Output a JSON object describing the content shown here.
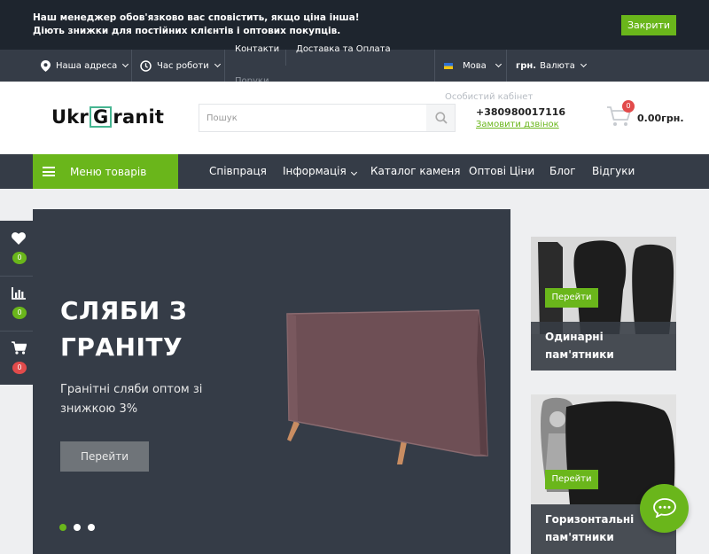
{
  "notice": {
    "line1": "Наш менеджер обов'язково вас сповістить, якщо ціна інша!",
    "line2": "Діють знижки для постійних клієнтів і оптових покупців.",
    "close_label": "Закрити"
  },
  "topbar": {
    "address_label": "Наша адреса",
    "hours_label": "Час роботи",
    "links": [
      "Контакти",
      "Доставка та Оплата",
      "Поруки"
    ],
    "language_label": "Мова",
    "currency_code": "грн.",
    "currency_label": "Валюта",
    "account_label": "Особистий кабінет"
  },
  "header": {
    "logo_pre": "Ukr",
    "logo_g": "G",
    "logo_post": "ranit",
    "search_placeholder": "Пошук",
    "phone": "+380980017116",
    "callback_label": "Замовити дзвінок",
    "cart_count": "0",
    "cart_total": "0.00грн."
  },
  "nav": {
    "menu_label": "Меню товарів",
    "items": [
      "Співпраця",
      "Інформація",
      "Каталог каменя",
      "Оптові Ціни",
      "Блог",
      "Відгуки"
    ]
  },
  "side": {
    "wishlist_count": "0",
    "compare_count": "0",
    "cart_count": "0"
  },
  "slider": {
    "title_line1": "СЛЯБИ З",
    "title_line2": "ГРАНІТУ",
    "subtitle_line1": "Гранітні сляби оптом зі",
    "subtitle_line2": "знижкою 3%",
    "button_label": "Перейти"
  },
  "cards": [
    {
      "button_label": "Перейти",
      "caption_line1": "Одинарні",
      "caption_line2": "пам'ятники"
    },
    {
      "button_label": "Перейти",
      "caption_line1": "Горизонтальні",
      "caption_line2": "пам'ятники"
    }
  ],
  "colors": {
    "accent": "#6ab61b",
    "dark": "#353c47",
    "notice_bg": "#1e252e",
    "badge_red": "#e24b4b"
  }
}
